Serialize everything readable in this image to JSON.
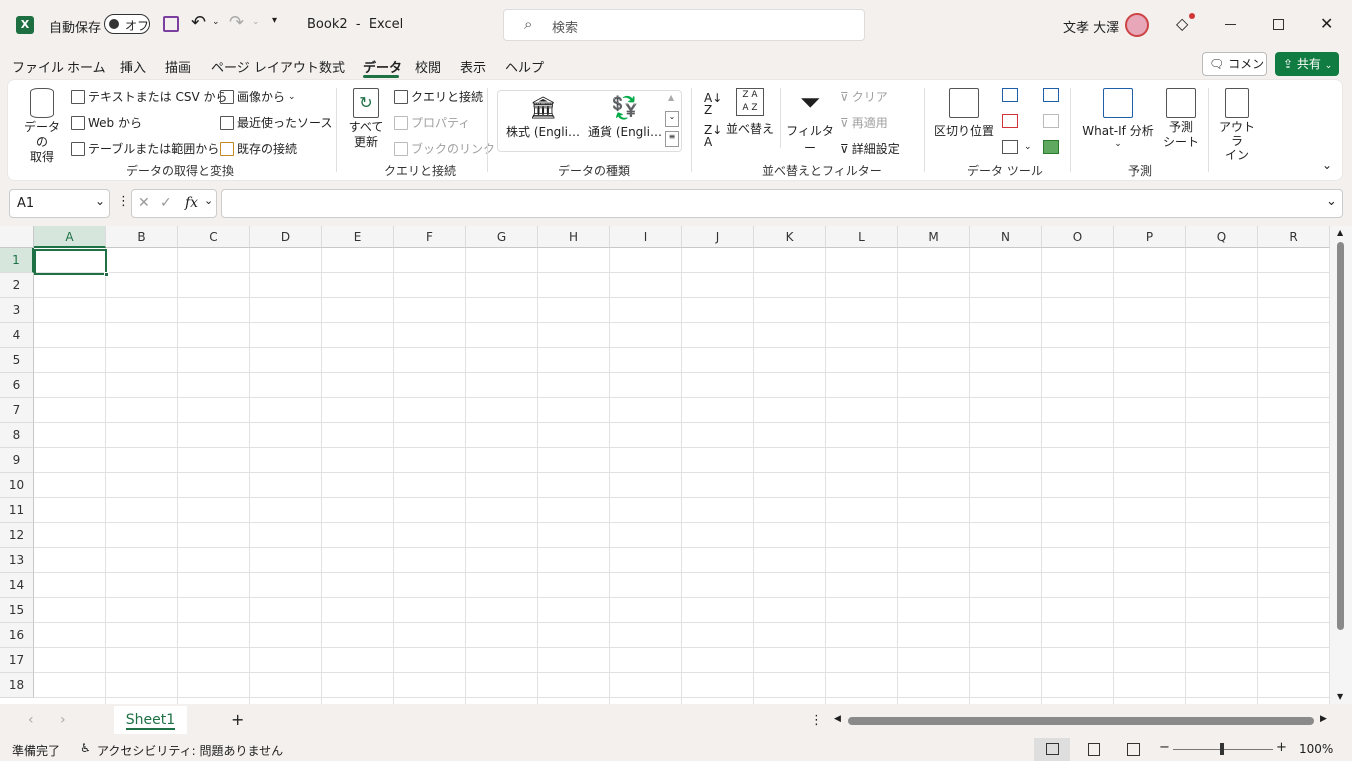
{
  "title": {
    "autosave": "自動保存",
    "autosave_state": "オフ",
    "doc": "Book2  -  Excel",
    "search_placeholder": "検索",
    "user": "文孝 大澤"
  },
  "tabs": [
    "ファイル",
    "ホーム",
    "挿入",
    "描画",
    "ページ レイアウト",
    "数式",
    "データ",
    "校閲",
    "表示",
    "ヘルプ"
  ],
  "active_tab": "データ",
  "buttons": {
    "comment": "コメント",
    "share": "共有"
  },
  "ribbon": {
    "get_data": "データの\n取得",
    "text_csv": "テキストまたは CSV から",
    "web": "Web から",
    "table_range": "テーブルまたは範囲から",
    "from_picture": "画像から",
    "recent_sources": "最近使ったソース",
    "existing_conn": "既存の接続",
    "group1": "データの取得と変換",
    "refresh_all": "すべて\n更新",
    "queries_conn": "クエリと接続",
    "properties": "プロパティ",
    "edit_links": "ブックのリンク",
    "group2": "クエリと接続",
    "stocks": "株式 (Engli…",
    "currencies": "通貨 (Engli…",
    "group3": "データの種類",
    "sort": "並べ替え",
    "filter": "フィルター",
    "clear": "クリア",
    "reapply": "再適用",
    "advanced": "詳細設定",
    "group4": "並べ替えとフィルター",
    "text_to_columns": "区切り位置",
    "group5": "データ ツール",
    "whatif": "What-If 分析",
    "forecast_sheet": "予測\nシート",
    "group6": "予測",
    "outline": "アウトラ\nイン"
  },
  "formula": {
    "namebox": "A1",
    "fx": "fx"
  },
  "columns": [
    "A",
    "B",
    "C",
    "D",
    "E",
    "F",
    "G",
    "H",
    "I",
    "J",
    "K",
    "L",
    "M",
    "N",
    "O",
    "P",
    "Q",
    "R"
  ],
  "rows": [
    "1",
    "2",
    "3",
    "4",
    "5",
    "6",
    "7",
    "8",
    "9",
    "10",
    "11",
    "12",
    "13",
    "14",
    "15",
    "16",
    "17",
    "18"
  ],
  "sheet": {
    "name": "Sheet1",
    "add": "+"
  },
  "status": {
    "ready": "準備完了",
    "accessibility": "アクセシビリティ: 問題ありません",
    "zoom": "100%"
  },
  "colors": {
    "excel_green": "#217346",
    "share_green": "#107c41",
    "accent": "#1e7145"
  }
}
